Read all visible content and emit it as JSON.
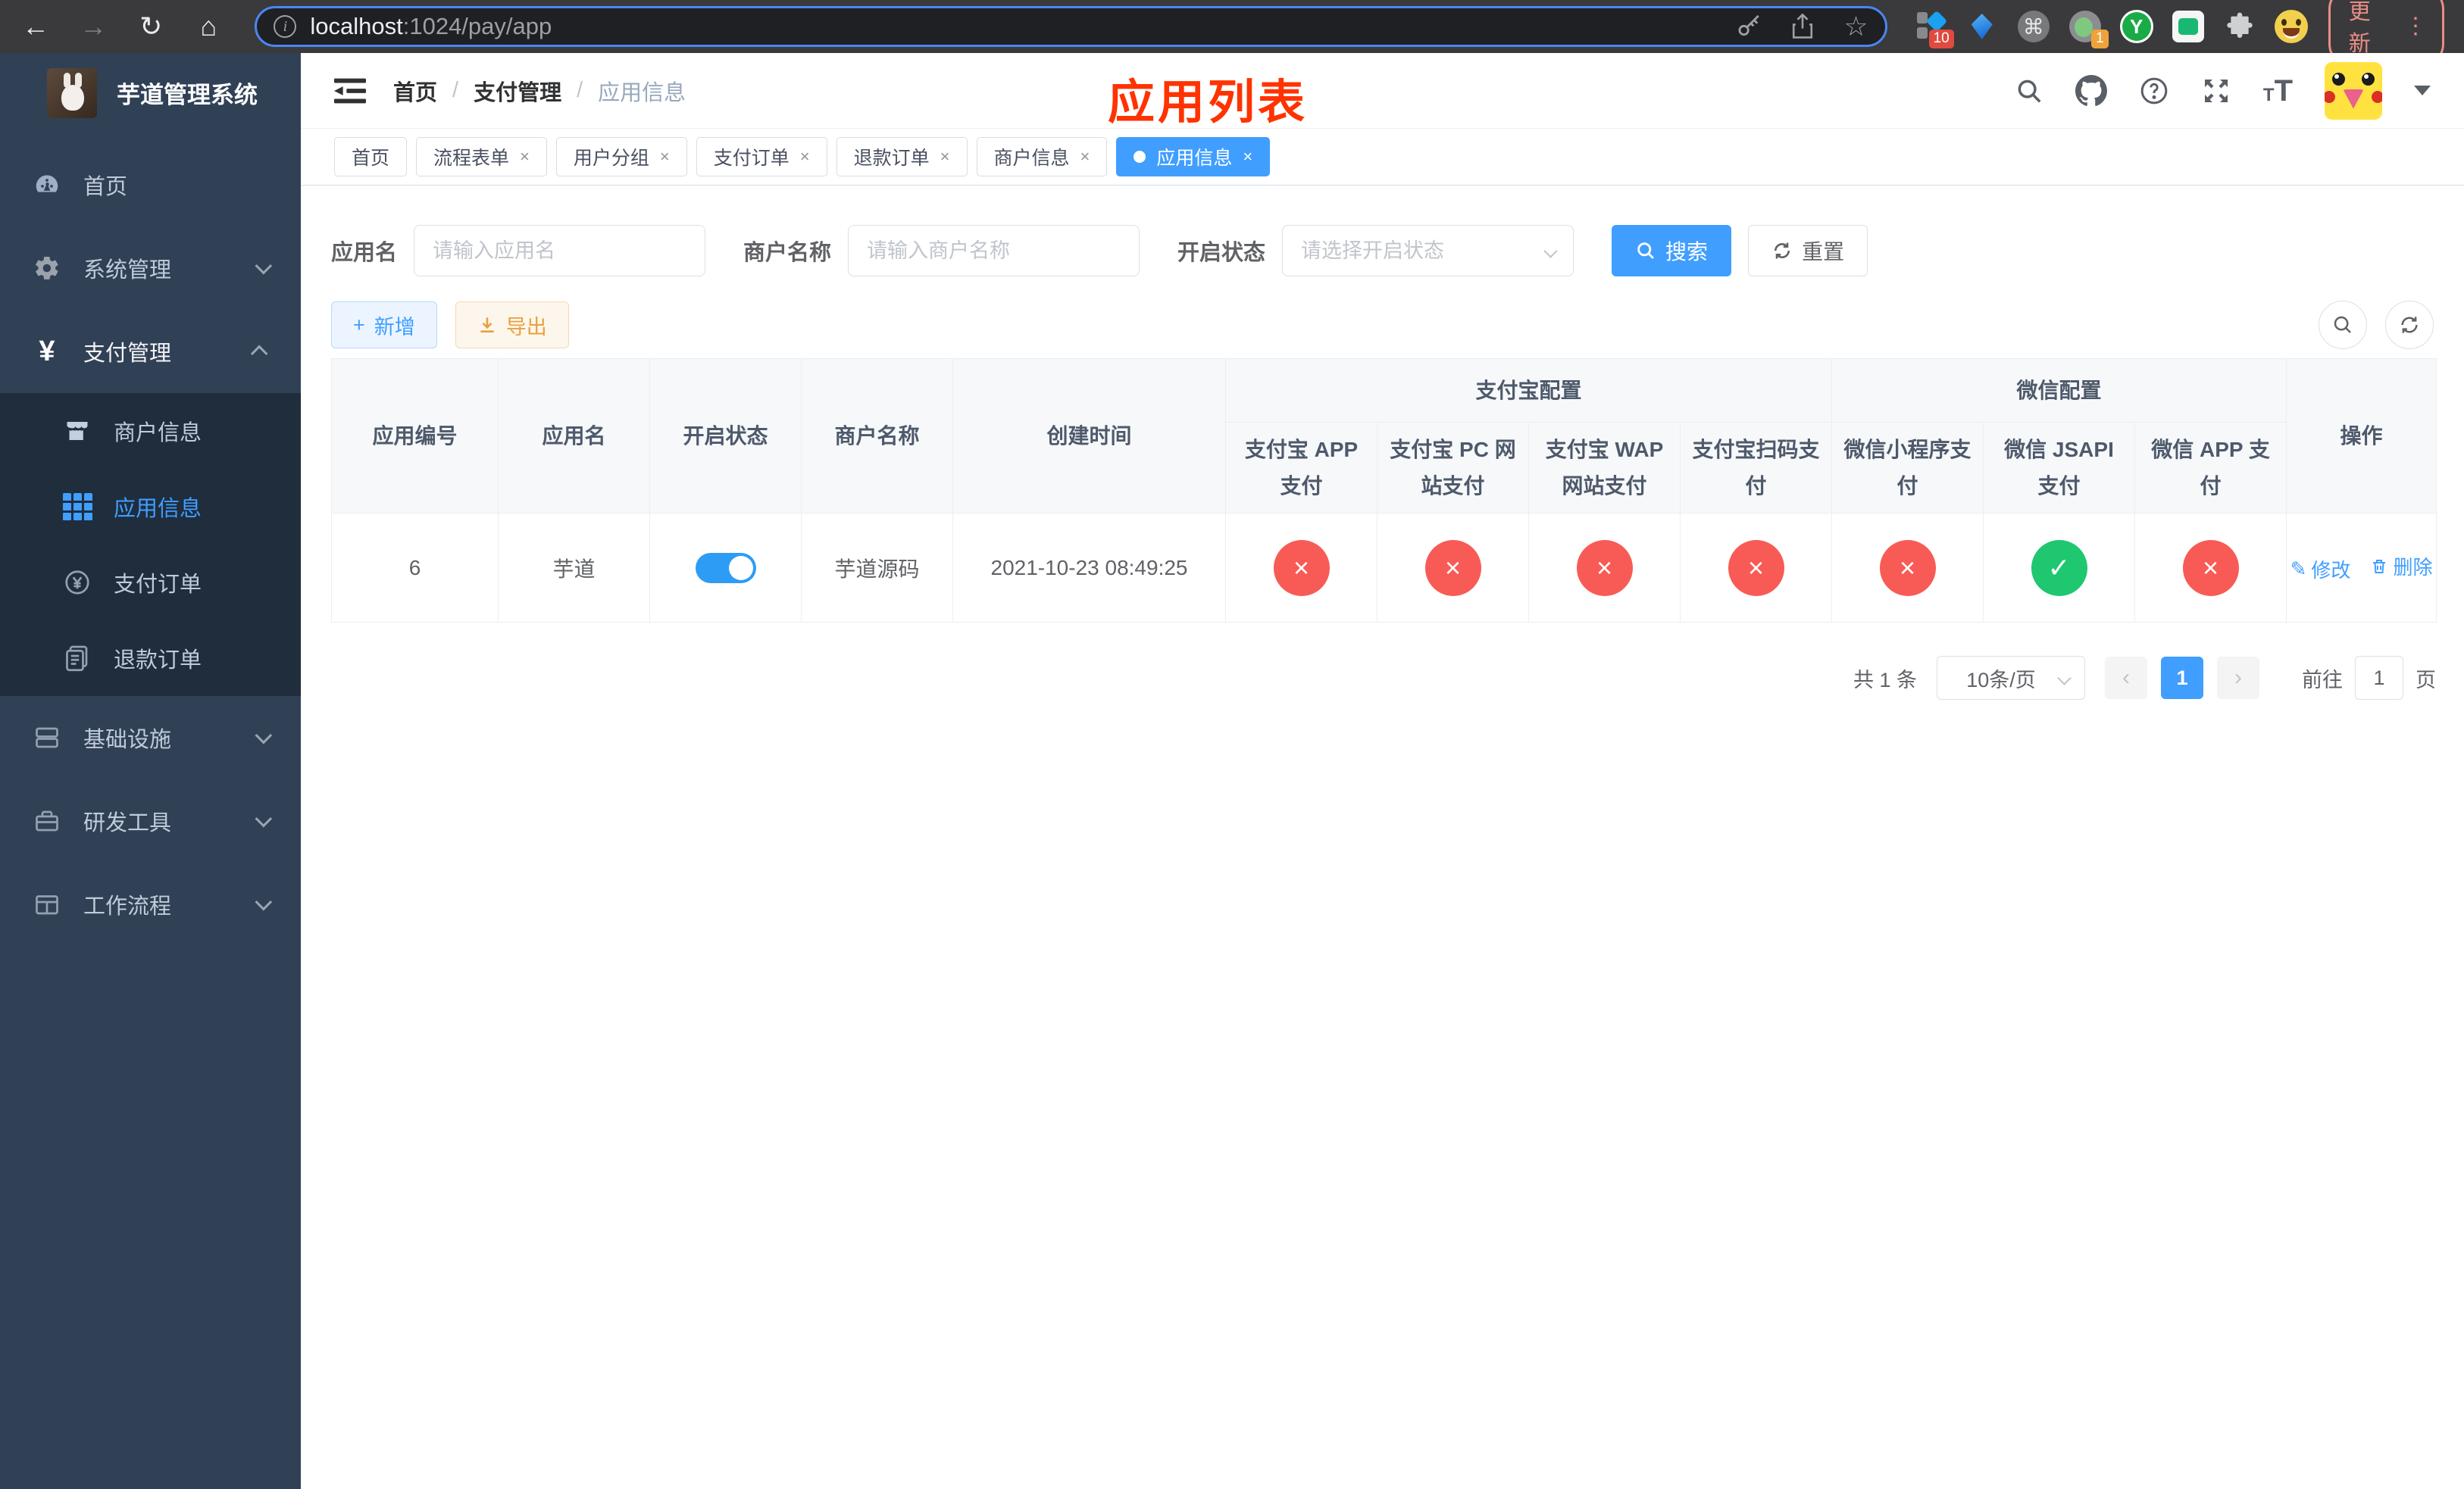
{
  "browser": {
    "url": {
      "host": "localhost",
      "rest": ":1024/pay/app"
    },
    "update_label": "更新",
    "ext_badges": {
      "panel": "10",
      "recorder": "1"
    },
    "ext_y_letter": "Y"
  },
  "sidebar": {
    "title": "芋道管理系统",
    "items": [
      {
        "label": "首页"
      },
      {
        "label": "系统管理"
      },
      {
        "label": "支付管理"
      },
      {
        "label": "商户信息"
      },
      {
        "label": "应用信息"
      },
      {
        "label": "支付订单"
      },
      {
        "label": "退款订单"
      },
      {
        "label": "基础设施"
      },
      {
        "label": "研发工具"
      },
      {
        "label": "工作流程"
      }
    ]
  },
  "navbar": {
    "breadcrumb": [
      "首页",
      "支付管理",
      "应用信息"
    ],
    "separator": "/"
  },
  "annotation": "应用列表",
  "tabs": [
    {
      "label": "首页"
    },
    {
      "label": "流程表单"
    },
    {
      "label": "用户分组"
    },
    {
      "label": "支付订单"
    },
    {
      "label": "退款订单"
    },
    {
      "label": "商户信息"
    },
    {
      "label": "应用信息"
    }
  ],
  "filters": {
    "app_name_label": "应用名",
    "app_name_placeholder": "请输入应用名",
    "merchant_label": "商户名称",
    "merchant_placeholder": "请输入商户名称",
    "status_label": "开启状态",
    "status_placeholder": "请选择开启状态",
    "search_label": "搜索",
    "reset_label": "重置"
  },
  "toolbar": {
    "add_label": "新增",
    "export_label": "导出"
  },
  "table": {
    "groups": {
      "alipay": "支付宝配置",
      "wechat": "微信配置"
    },
    "columns": {
      "id": "应用编号",
      "name": "应用名",
      "status": "开启状态",
      "merchant": "商户名称",
      "created": "创建时间",
      "alipay_app": "支付宝 APP 支付",
      "alipay_pc": "支付宝 PC 网站支付",
      "alipay_wap": "支付宝 WAP 网站支付",
      "alipay_scan": "支付宝扫码支付",
      "wx_mini": "微信小程序支付",
      "wx_jsapi": "微信 JSAPI 支付",
      "wx_app": "微信 APP 支付",
      "actions": "操作"
    },
    "rows": [
      {
        "id": "6",
        "name": "芋道",
        "enabled": true,
        "merchant": "芋道源码",
        "created": "2021-10-23 08:49:25",
        "alipay_app": false,
        "alipay_pc": false,
        "alipay_wap": false,
        "alipay_scan": false,
        "wx_mini": false,
        "wx_jsapi": true,
        "wx_app": false
      }
    ],
    "edit_label": "修改",
    "delete_label": "删除"
  },
  "pagination": {
    "total": "共 1 条",
    "page_size": "10条/页",
    "current": "1",
    "goto_label": "前往",
    "goto_value": "1",
    "unit_label": "页"
  },
  "icons": {
    "back": "←",
    "forward": "→",
    "reload": "↻",
    "home": "⌂",
    "star": "☆",
    "command": "⌘",
    "dots": "⋮",
    "close_glyph": "×",
    "check_glyph": "✓",
    "plus_glyph": "+",
    "prev_glyph": "‹",
    "next_glyph": "›",
    "edit_glyph": "✎"
  },
  "colors": {
    "primary": "#409eff",
    "danger": "#f85b56",
    "success": "#1ec770",
    "warning": "#e6a23c",
    "sidebar_bg": "#304156",
    "submenu_bg": "#1f2d3d",
    "annotation_red": "#ff3300"
  }
}
